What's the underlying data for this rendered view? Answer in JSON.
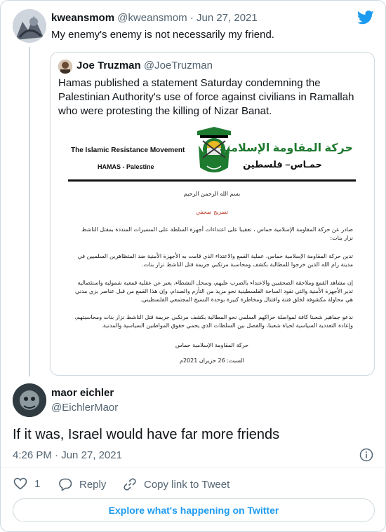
{
  "tweet": {
    "display_name": "kweansmom",
    "handle": "@kweansmom",
    "separator": "·",
    "date": "Jun 27, 2021",
    "text": "My enemy's enemy is not necessarily my friend."
  },
  "quoted": {
    "display_name": "Joe Truzman",
    "handle": "@JoeTruzman",
    "text": "Hamas published a statement Saturday condemning the Palestinian Authority's use of force against civilians in Ramallah who were protesting the killing of Nizar Banat.",
    "document": {
      "org_en": "The Islamic Resistance Movement",
      "org_en_sub": "HAMAS - Palestine",
      "org_ar": "حركة المقاومة الإسلامية",
      "org_ar_sub": "حمـاس– فلسطين",
      "basmala": "بسم الله الرحمن الرحيم",
      "statement_title": "تصريح صحفي",
      "p1": "صادر عن حركة المقاومة الإسلامية حماس ، تعقيبا على اعتداءات أجهزة السلطة على المسيرات المنددة بمقتل الناشط نزار بنات:",
      "p2": "تدين حركة المقاومة الإسلامية حماس، عملية القمع والاعتداء الذي قامت به الأجهزة الأمنية ضد المتظاهرين السلميين في مدينة رام الله الذين خرجوا للمطالبة بكشف ومحاسبة مرتكبي جريمة قتل الناشط نزار بنات.",
      "p3": "إن مشاهد القمع وملاحقة الصحفيين والاعتداء بالضرب عليهم، وسحل النشطاء، يعبر عن عقلية قمعية شمولية واستئصالية تدير الأجهزة الأمنية والتي تقود الساحة الفلسطينية نحو مزيد من التأزم والصدام، وإن هذا القمع من قبل عناصر بزي مدني هي محاولة مكشوفة لخلق فتنة واقتتال ومخاطرة كبيرة بوحدة النسيج المجتمعي الفلسطيني.",
      "p4": "ندعو جماهير شعبنا كافة لمواصلة حراكهم السلمي نحو المطالبة بكشف مرتكبي جريمة قتل الناشط نزار بنات ومحاسبتهم، وإعادة التعددية السياسية لحياة شعبنا، والفصل بين السلطات الذي يحمي حقوق المواطنين السياسية والمدنية.",
      "signature": "حركة المقاومة الإسلامية حماس",
      "date": "السبت: 26 حزيران 2021م"
    }
  },
  "reply": {
    "display_name": "maor eichler",
    "handle": "@EichlerMaor",
    "text": "If it was, Israel would have far more friends",
    "time": "4:26 PM",
    "separator": "·",
    "date": "Jun 27, 2021"
  },
  "actions": {
    "like_count": "1",
    "reply_label": "Reply",
    "copy_link_label": "Copy link to Tweet"
  },
  "explore_label": "Explore what's happening on Twitter",
  "colors": {
    "twitter_blue": "#1d9bf0",
    "muted": "#536471",
    "border": "#cfd9de",
    "hamas_green": "#1e7a2f",
    "statement_red": "#c0392b"
  }
}
